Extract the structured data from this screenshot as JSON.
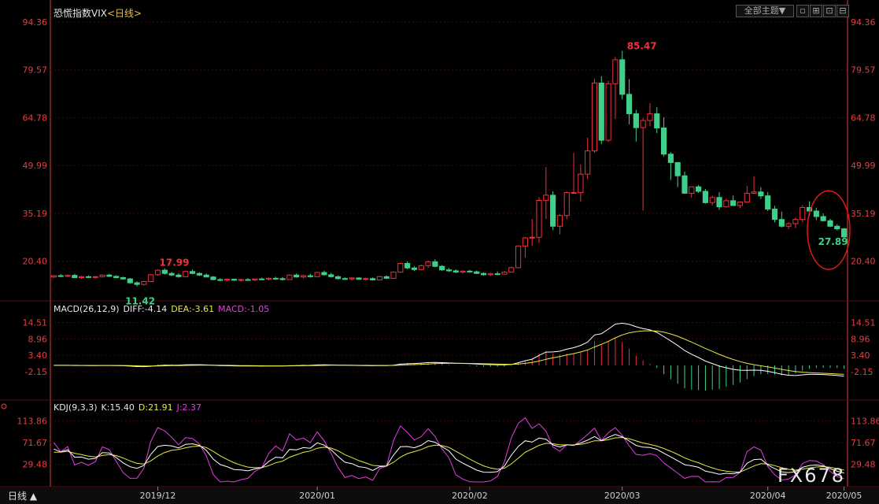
{
  "title": {
    "name": "恐慌指数VIX",
    "timeframe": "<日线>"
  },
  "top_buttons": {
    "theme": "全部主题▼",
    "b1": "▫",
    "b2": "⊞",
    "b3": "⊡",
    "b4": "⊟"
  },
  "colors": {
    "up": "#f0303a",
    "down": "#3ed08a",
    "bg": "#000000",
    "grid": "#3a0a0a",
    "axis": "#e04040",
    "diff": "#ffffff",
    "dea": "#e8e840",
    "macd": "#e040e0",
    "k": "#ffffff",
    "d": "#e8e840",
    "j": "#e040e0"
  },
  "chart_data": [
    {
      "type": "candlestick",
      "yticks": [
        20.4,
        35.19,
        49.99,
        64.78,
        79.57,
        94.36
      ],
      "ylim": [
        13.0,
        94.36
      ],
      "x_labels": [
        "2019/12",
        "2020/01",
        "2020/02",
        "2020/03",
        "2020/04",
        "2020/05"
      ],
      "annotations": [
        {
          "label": "85.47",
          "kind": "high"
        },
        {
          "label": "17.99",
          "kind": "high"
        },
        {
          "label": "11.42",
          "kind": "low"
        },
        {
          "label": "27.89",
          "kind": "last"
        }
      ],
      "candles": [
        [
          15.5,
          16.1,
          15.2,
          15.9
        ],
        [
          15.9,
          16.4,
          15.5,
          15.7
        ],
        [
          15.7,
          16.3,
          15.4,
          16.0
        ],
        [
          16.0,
          16.5,
          15.1,
          15.3
        ],
        [
          15.3,
          15.9,
          14.9,
          15.6
        ],
        [
          15.6,
          16.0,
          15.2,
          15.4
        ],
        [
          15.4,
          15.8,
          15.0,
          15.6
        ],
        [
          15.6,
          16.3,
          15.3,
          16.1
        ],
        [
          16.1,
          16.5,
          15.5,
          15.7
        ],
        [
          15.7,
          16.0,
          15.1,
          15.3
        ],
        [
          15.3,
          15.6,
          14.7,
          14.9
        ],
        [
          14.9,
          15.2,
          13.4,
          13.7
        ],
        [
          13.7,
          14.2,
          12.6,
          13.2
        ],
        [
          13.2,
          14.3,
          12.9,
          14.1
        ],
        [
          14.1,
          16.4,
          13.9,
          16.2
        ],
        [
          16.2,
          17.9,
          15.9,
          17.6
        ],
        [
          17.6,
          18.2,
          16.2,
          16.6
        ],
        [
          16.6,
          17.1,
          15.8,
          16.1
        ],
        [
          16.1,
          16.7,
          15.3,
          15.6
        ],
        [
          15.6,
          17.5,
          15.4,
          17.2
        ],
        [
          17.2,
          17.8,
          16.3,
          16.6
        ],
        [
          16.6,
          17.0,
          15.8,
          16.1
        ],
        [
          16.1,
          16.6,
          15.4,
          15.5
        ],
        [
          15.5,
          15.8,
          14.5,
          14.7
        ],
        [
          14.7,
          15.1,
          14.2,
          14.5
        ],
        [
          14.5,
          15.0,
          14.2,
          14.8
        ],
        [
          14.8,
          15.0,
          14.3,
          14.5
        ],
        [
          14.5,
          14.9,
          14.1,
          14.7
        ],
        [
          14.7,
          15.1,
          14.3,
          14.6
        ],
        [
          14.6,
          15.0,
          14.2,
          14.9
        ],
        [
          14.9,
          15.3,
          14.5,
          14.8
        ],
        [
          14.8,
          15.3,
          14.4,
          15.1
        ],
        [
          15.1,
          15.6,
          14.7,
          15.0
        ],
        [
          15.0,
          15.5,
          14.4,
          14.7
        ],
        [
          14.7,
          16.3,
          14.6,
          16.1
        ],
        [
          16.1,
          16.6,
          15.3,
          15.5
        ],
        [
          15.5,
          16.2,
          15.1,
          15.9
        ],
        [
          15.9,
          16.5,
          15.3,
          15.6
        ],
        [
          15.6,
          17.1,
          15.4,
          16.9
        ],
        [
          16.9,
          17.5,
          15.9,
          16.2
        ],
        [
          16.2,
          16.8,
          15.3,
          15.6
        ],
        [
          15.6,
          16.0,
          14.7,
          15.0
        ],
        [
          15.0,
          15.4,
          14.6,
          14.9
        ],
        [
          14.9,
          15.5,
          14.4,
          15.2
        ],
        [
          15.2,
          15.4,
          14.6,
          14.8
        ],
        [
          14.8,
          15.3,
          14.4,
          15.0
        ],
        [
          15.0,
          15.4,
          14.4,
          14.6
        ],
        [
          14.6,
          15.8,
          14.5,
          15.6
        ],
        [
          15.6,
          16.0,
          14.9,
          15.1
        ],
        [
          15.1,
          17.3,
          15.0,
          17.0
        ],
        [
          17.0,
          19.9,
          16.8,
          19.7
        ],
        [
          19.7,
          20.4,
          17.9,
          18.3
        ],
        [
          18.3,
          18.8,
          17.4,
          17.8
        ],
        [
          17.8,
          19.3,
          17.6,
          19.0
        ],
        [
          19.0,
          20.6,
          18.3,
          20.2
        ],
        [
          20.2,
          21.0,
          18.5,
          18.8
        ],
        [
          18.8,
          19.2,
          17.4,
          17.7
        ],
        [
          17.7,
          18.3,
          17.1,
          17.4
        ],
        [
          17.4,
          17.9,
          16.7,
          17.0
        ],
        [
          17.0,
          17.6,
          16.6,
          17.3
        ],
        [
          17.3,
          17.7,
          16.8,
          17.1
        ],
        [
          17.1,
          17.5,
          16.4,
          16.6
        ],
        [
          16.6,
          17.0,
          15.9,
          16.2
        ],
        [
          16.2,
          16.8,
          15.8,
          16.5
        ],
        [
          16.5,
          17.2,
          16.1,
          16.4
        ],
        [
          16.4,
          17.3,
          16.2,
          17.0
        ],
        [
          17.0,
          18.7,
          16.9,
          18.4
        ],
        [
          18.4,
          25.3,
          18.2,
          25.1
        ],
        [
          25.1,
          27.9,
          21.5,
          27.6
        ],
        [
          27.6,
          33.5,
          25.2,
          27.8
        ],
        [
          27.8,
          40.2,
          26.0,
          39.2
        ],
        [
          39.2,
          49.5,
          33.4,
          40.8
        ],
        [
          40.8,
          42.0,
          30.0,
          31.2
        ],
        [
          31.2,
          35.0,
          28.7,
          34.5
        ],
        [
          34.5,
          41.9,
          33.3,
          41.6
        ],
        [
          41.6,
          53.9,
          41.3,
          41.6
        ],
        [
          41.6,
          50.3,
          38.8,
          47.3
        ],
        [
          47.3,
          58.6,
          45.8,
          54.5
        ],
        [
          54.5,
          76.8,
          53.9,
          75.5
        ],
        [
          75.5,
          77.6,
          56.6,
          57.8
        ],
        [
          57.8,
          76.2,
          57.2,
          75.3
        ],
        [
          75.3,
          83.6,
          64.3,
          82.7
        ],
        [
          82.7,
          85.47,
          70.4,
          72.0
        ],
        [
          72.0,
          76.7,
          62.7,
          66.0
        ],
        [
          66.0,
          67.2,
          57.4,
          61.7
        ],
        [
          61.7,
          64.7,
          36.1,
          63.9
        ],
        [
          63.9,
          69.3,
          62.1,
          66.0
        ],
        [
          66.0,
          68.0,
          60.0,
          61.6
        ],
        [
          61.6,
          64.9,
          52.8,
          53.5
        ],
        [
          53.5,
          54.1,
          45.5,
          50.9
        ],
        [
          50.9,
          51.0,
          43.3,
          46.8
        ],
        [
          46.8,
          48.1,
          41.7,
          41.4
        ],
        [
          41.4,
          43.0,
          40.1,
          43.4
        ],
        [
          43.4,
          44.0,
          41.5,
          42.0
        ],
        [
          42.0,
          42.7,
          38.2,
          38.5
        ],
        [
          38.5,
          40.6,
          37.6,
          40.1
        ],
        [
          40.1,
          41.8,
          36.3,
          37.2
        ],
        [
          37.2,
          39.7,
          37.0,
          39.1
        ],
        [
          39.1,
          40.7,
          37.6,
          37.6
        ],
        [
          37.6,
          38.2,
          36.8,
          38.7
        ],
        [
          38.7,
          43.6,
          38.5,
          41.4
        ],
        [
          41.4,
          46.7,
          41.2,
          41.8
        ],
        [
          41.8,
          43.3,
          39.6,
          40.6
        ],
        [
          40.6,
          41.8,
          35.9,
          36.5
        ],
        [
          36.5,
          37.5,
          32.4,
          33.3
        ],
        [
          33.3,
          35.7,
          30.8,
          31.2
        ],
        [
          31.2,
          32.4,
          30.3,
          32.0
        ],
        [
          32.0,
          33.9,
          30.6,
          33.3
        ],
        [
          33.3,
          37.7,
          32.4,
          37.0
        ],
        [
          37.0,
          38.9,
          34.4,
          35.9
        ],
        [
          35.9,
          36.9,
          33.1,
          34.2
        ],
        [
          34.2,
          35.2,
          32.7,
          32.9
        ],
        [
          32.9,
          33.5,
          30.9,
          31.2
        ],
        [
          31.2,
          31.8,
          29.9,
          30.4
        ],
        [
          30.4,
          30.6,
          27.2,
          27.89
        ]
      ]
    },
    {
      "type": "macd",
      "params": "MACD(26,12,9)",
      "diff_label": "DIFF:-4.14",
      "dea_label": "DEA:-3.61",
      "macd_label": "MACD:-1.05",
      "yticks": [
        -2.15,
        3.4,
        8.96,
        14.51
      ],
      "ylim": [
        -7.5,
        16.5
      ]
    },
    {
      "type": "kdj",
      "params": "KDJ(9,3,3)",
      "k_label": "K:15.40",
      "d_label": "D:21.91",
      "j_label": "J:2.37",
      "yticks": [
        29.48,
        71.67,
        113.86
      ],
      "ylim": [
        -5,
        124
      ]
    }
  ],
  "period_button": "日线 ▲",
  "watermark": "FX678"
}
